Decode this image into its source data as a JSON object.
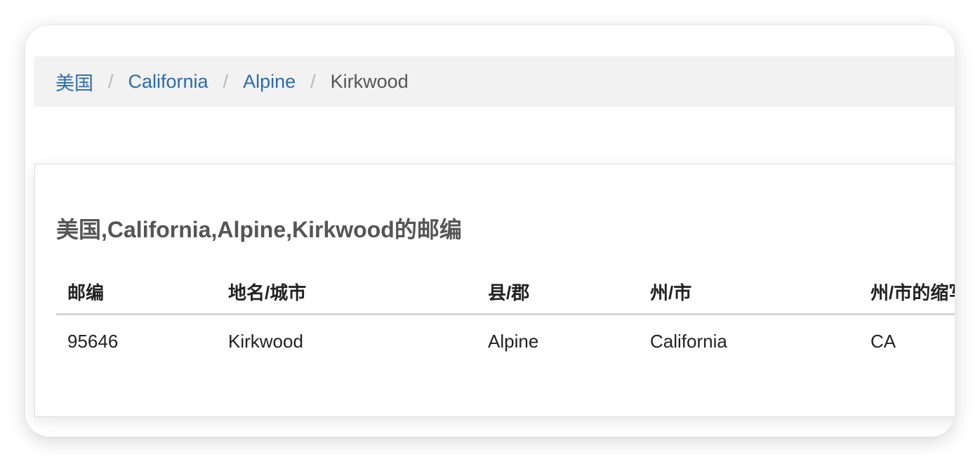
{
  "breadcrumb": {
    "items": [
      {
        "label": "美国"
      },
      {
        "label": "California"
      },
      {
        "label": "Alpine"
      }
    ],
    "separator": "/",
    "current": "Kirkwood"
  },
  "card": {
    "title": "美国,California,Alpine,Kirkwood的邮编"
  },
  "table": {
    "headers": [
      "邮编",
      "地名/城市",
      "县/郡",
      "州/市",
      "州/市的缩写"
    ],
    "rows": [
      [
        "95646",
        "Kirkwood",
        "Alpine",
        "California",
        "CA"
      ]
    ]
  },
  "colors": {
    "link": "#2a6cad",
    "breadcrumb_bg": "#f2f2f2",
    "title": "#555555"
  }
}
